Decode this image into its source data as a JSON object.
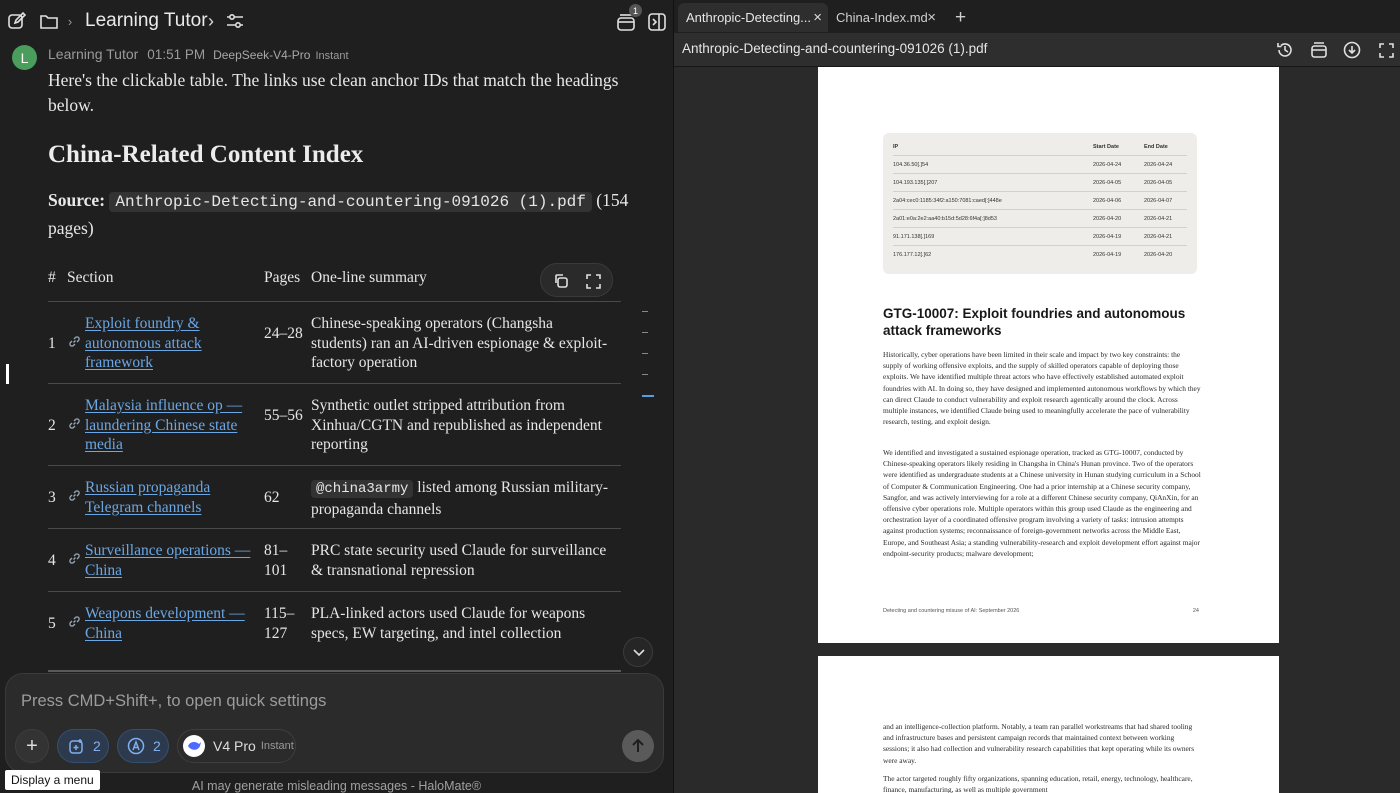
{
  "header": {
    "breadcrumb_title": "Learning Tutor",
    "notification_count": "1"
  },
  "message": {
    "avatar_letter": "L",
    "author": "Learning Tutor",
    "time": "01:51 PM",
    "model": "DeepSeek-V4-Pro",
    "mode": "Instant",
    "intro": "Here's the clickable table. The links use clean anchor IDs that match the headings below.",
    "heading": "China-Related Content Index",
    "source_label": "Source:",
    "source_file": "Anthropic-Detecting-and-countering-091026 (1).pdf",
    "source_pages": "(154 pages)"
  },
  "table": {
    "headers": {
      "num": "#",
      "section": "Section",
      "pages": "Pages",
      "summary": "One-line summary"
    },
    "rows": [
      {
        "num": "1",
        "section": "Exploit foundry & autonomous attack framework",
        "pages": "24–28",
        "summary_code": "",
        "summary": "Chinese-speaking operators (Changsha students) ran an AI-driven espionage & exploit-factory operation"
      },
      {
        "num": "2",
        "section": "Malaysia influence op — laundering Chinese state media",
        "pages": "55–56",
        "summary_code": "",
        "summary": "Synthetic outlet stripped attribution from Xinhua/CGTN and republished as independent reporting"
      },
      {
        "num": "3",
        "section": "Russian propaganda Telegram channels",
        "pages": "62",
        "summary_code": "@china3army",
        "summary": "listed among Russian military-propaganda channels"
      },
      {
        "num": "4",
        "section": "Surveillance operations — China",
        "pages": "81–101",
        "summary_code": "",
        "summary": "PRC state security used Claude for surveillance & transnational repression"
      },
      {
        "num": "5",
        "section": "Weapons development — China",
        "pages": "115–127",
        "summary_code": "",
        "summary": "PLA-linked actors used Claude for weapons specs, EW targeting, and intel collection"
      }
    ]
  },
  "composer": {
    "placeholder": "Press CMD+Shift+, to open quick settings",
    "tools_count": "2",
    "agents_count": "2",
    "model_name": "V4 Pro",
    "model_mode": "Instant"
  },
  "tooltip": "Display a menu",
  "disclaimer": "AI may generate misleading messages - HaloMate®",
  "viewer": {
    "tabs": [
      {
        "label": "Anthropic-Detecting...",
        "active": true
      },
      {
        "label": "China-Index.md",
        "active": false
      }
    ],
    "file_title": "Anthropic-Detecting-and-countering-091026 (1).pdf",
    "pdf_table": {
      "headers": [
        "IP",
        "Start Date",
        "End Date"
      ],
      "rows": [
        [
          "104.36.50[.]54",
          "2026-04-24",
          "2026-04-24"
        ],
        [
          "104.193.135[.]207",
          "2026-04-05",
          "2026-04-05"
        ],
        [
          "2a04:cec0:1185:34f2:a150:7081:caed[:]448e",
          "2026-04-06",
          "2026-04-07"
        ],
        [
          "2a01:e0a:2e2:aa40:b15d:5d28:6f4a[:]8d53",
          "2026-04-20",
          "2026-04-21"
        ],
        [
          "91.171.138[.]169",
          "2026-04-19",
          "2026-04-21"
        ],
        [
          "176.177.12[.]62",
          "2026-04-19",
          "2026-04-20"
        ]
      ]
    },
    "page1_heading": "GTG-10007: Exploit foundries and autonomous attack frameworks",
    "page1_para1": "Historically, cyber operations have been limited in their scale and impact by two key constraints: the supply of working offensive exploits, and the supply of skilled operators capable of deploying those exploits. We have identified multiple threat actors who have effectively established automated exploit foundries with AI. In doing so, they have designed and implemented autonomous workflows by which they can direct Claude to conduct vulnerability and exploit research agentically around the clock. Across multiple instances, we identified Claude being used to meaningfully accelerate the pace of vulnerability research, testing, and exploit design.",
    "page1_para2": "We identified and investigated a sustained espionage operation, tracked as GTG-10007, conducted by Chinese-speaking operators likely residing in Changsha in China's Hunan province. Two of the operators were identified as undergraduate students at a Chinese university in Hunan studying curriculum in a School of Computer & Communication Engineering. One had a prior internship at a Chinese security company, Sangfor, and was actively interviewing for a role at a different Chinese security company, QiAnXin, for an offensive cyber operations role. Multiple operators within this group used Claude as the engineering and orchestration layer of a coordinated offensive program involving a variety of tasks: intrusion attempts against production systems; reconnaissance of foreign-government networks across the Middle East, Europe, and Southeast Asia; a standing vulnerability-research and exploit development effort against major endpoint-security products; malware development;",
    "page1_footer": "Detecting and countering misuse of AI: September 2026",
    "page1_number": "24",
    "page2_para1": "and an intelligence-collection platform. Notably, a team ran parallel workstreams that had shared tooling and infrastructure bases and persistent campaign records that maintained context between working sessions; it also had collection and vulnerability research capabilities that kept operating while its owners were away.",
    "page2_para2": "The actor targeted roughly fifty organizations, spanning education, retail, energy, technology, healthcare, finance, manufacturing, as well as multiple government"
  }
}
